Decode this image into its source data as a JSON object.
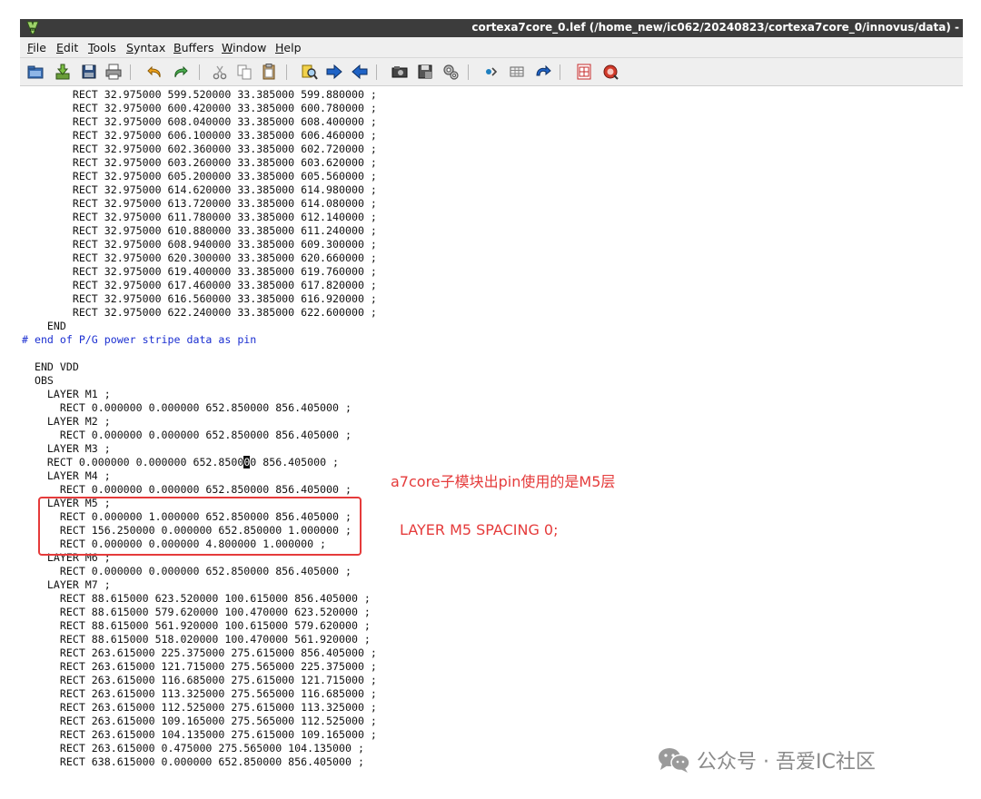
{
  "window": {
    "title": "cortexa7core_0.lef (/home_new/ic062/20240823/cortexa7core_0/innovus/data) -"
  },
  "menu": [
    {
      "pre": "",
      "mn": "F",
      "post": "ile"
    },
    {
      "pre": "",
      "mn": "E",
      "post": "dit"
    },
    {
      "pre": "",
      "mn": "T",
      "post": "ools"
    },
    {
      "pre": "",
      "mn": "S",
      "post": "yntax"
    },
    {
      "pre": "",
      "mn": "B",
      "post": "uffers"
    },
    {
      "pre": "",
      "mn": "W",
      "post": "indow"
    },
    {
      "pre": "",
      "mn": "H",
      "post": "elp"
    }
  ],
  "toolbar_icons": [
    "open-icon",
    "save-icon",
    "save-as-icon",
    "print-icon",
    "undo-icon",
    "redo-icon",
    "cut-icon",
    "copy-icon",
    "paste-icon",
    "find-replace-icon",
    "find-next-icon",
    "find-prev-icon",
    "load-session-icon",
    "save-session-icon",
    "run-script-icon",
    "make-icon",
    "ctags-icon",
    "jump-tag-icon",
    "help-icon",
    "find-help-icon"
  ],
  "colors": {
    "comment": "#1b2fd1",
    "annotation": "#e53b3b",
    "titlebar": "#3c3c3c"
  },
  "cursor_line_index": 27,
  "cursor_line": {
    "before": "    RECT 0.000000 0.000000 652.8500",
    "char": "0",
    "after": "0 856.405000 ;"
  },
  "lines": [
    {
      "text": "        RECT 32.975000 599.520000 33.385000 599.880000 ;",
      "type": "code"
    },
    {
      "text": "        RECT 32.975000 600.420000 33.385000 600.780000 ;",
      "type": "code"
    },
    {
      "text": "        RECT 32.975000 608.040000 33.385000 608.400000 ;",
      "type": "code"
    },
    {
      "text": "        RECT 32.975000 606.100000 33.385000 606.460000 ;",
      "type": "code"
    },
    {
      "text": "        RECT 32.975000 602.360000 33.385000 602.720000 ;",
      "type": "code"
    },
    {
      "text": "        RECT 32.975000 603.260000 33.385000 603.620000 ;",
      "type": "code"
    },
    {
      "text": "        RECT 32.975000 605.200000 33.385000 605.560000 ;",
      "type": "code"
    },
    {
      "text": "        RECT 32.975000 614.620000 33.385000 614.980000 ;",
      "type": "code"
    },
    {
      "text": "        RECT 32.975000 613.720000 33.385000 614.080000 ;",
      "type": "code"
    },
    {
      "text": "        RECT 32.975000 611.780000 33.385000 612.140000 ;",
      "type": "code"
    },
    {
      "text": "        RECT 32.975000 610.880000 33.385000 611.240000 ;",
      "type": "code"
    },
    {
      "text": "        RECT 32.975000 608.940000 33.385000 609.300000 ;",
      "type": "code"
    },
    {
      "text": "        RECT 32.975000 620.300000 33.385000 620.660000 ;",
      "type": "code"
    },
    {
      "text": "        RECT 32.975000 619.400000 33.385000 619.760000 ;",
      "type": "code"
    },
    {
      "text": "        RECT 32.975000 617.460000 33.385000 617.820000 ;",
      "type": "code"
    },
    {
      "text": "        RECT 32.975000 616.560000 33.385000 616.920000 ;",
      "type": "code"
    },
    {
      "text": "        RECT 32.975000 622.240000 33.385000 622.600000 ;",
      "type": "code"
    },
    {
      "text": "    END",
      "type": "code"
    },
    {
      "text": "# end of P/G power stripe data as pin",
      "type": "comment"
    },
    {
      "text": "",
      "type": "code"
    },
    {
      "text": "  END VDD",
      "type": "code"
    },
    {
      "text": "  OBS",
      "type": "code"
    },
    {
      "text": "    LAYER M1 ;",
      "type": "code"
    },
    {
      "text": "      RECT 0.000000 0.000000 652.850000 856.405000 ;",
      "type": "code"
    },
    {
      "text": "    LAYER M2 ;",
      "type": "code"
    },
    {
      "text": "      RECT 0.000000 0.000000 652.850000 856.405000 ;",
      "type": "code"
    },
    {
      "text": "    LAYER M3 ;",
      "type": "code"
    },
    {
      "text": "      RECT 0.000000 0.000000 652.850000 856.405000 ;",
      "type": "code"
    },
    {
      "text": "    LAYER M4 ;",
      "type": "code"
    },
    {
      "text": "      RECT 0.000000 0.000000 652.850000 856.405000 ;",
      "type": "code"
    },
    {
      "text": "    LAYER M5 ;",
      "type": "code"
    },
    {
      "text": "      RECT 0.000000 1.000000 652.850000 856.405000 ;",
      "type": "code"
    },
    {
      "text": "      RECT 156.250000 0.000000 652.850000 1.000000 ;",
      "type": "code"
    },
    {
      "text": "      RECT 0.000000 0.000000 4.800000 1.000000 ;",
      "type": "code"
    },
    {
      "text": "    LAYER M6 ;",
      "type": "code"
    },
    {
      "text": "      RECT 0.000000 0.000000 652.850000 856.405000 ;",
      "type": "code"
    },
    {
      "text": "    LAYER M7 ;",
      "type": "code"
    },
    {
      "text": "      RECT 88.615000 623.520000 100.615000 856.405000 ;",
      "type": "code"
    },
    {
      "text": "      RECT 88.615000 579.620000 100.470000 623.520000 ;",
      "type": "code"
    },
    {
      "text": "      RECT 88.615000 561.920000 100.615000 579.620000 ;",
      "type": "code"
    },
    {
      "text": "      RECT 88.615000 518.020000 100.470000 561.920000 ;",
      "type": "code"
    },
    {
      "text": "      RECT 263.615000 225.375000 275.615000 856.405000 ;",
      "type": "code"
    },
    {
      "text": "      RECT 263.615000 121.715000 275.565000 225.375000 ;",
      "type": "code"
    },
    {
      "text": "      RECT 263.615000 116.685000 275.615000 121.715000 ;",
      "type": "code"
    },
    {
      "text": "      RECT 263.615000 113.325000 275.565000 116.685000 ;",
      "type": "code"
    },
    {
      "text": "      RECT 263.615000 112.525000 275.615000 113.325000 ;",
      "type": "code"
    },
    {
      "text": "      RECT 263.615000 109.165000 275.565000 112.525000 ;",
      "type": "code"
    },
    {
      "text": "      RECT 263.615000 104.135000 275.615000 109.165000 ;",
      "type": "code"
    },
    {
      "text": "      RECT 263.615000 0.475000 275.565000 104.135000 ;",
      "type": "code"
    },
    {
      "text": "      RECT 638.615000 0.000000 652.850000 856.405000 ;",
      "type": "code"
    }
  ],
  "annotations": {
    "note1": "a7core子模块出pin使用的是M5层",
    "note2": "LAYER M5 SPACING  0;"
  },
  "watermark": {
    "text": "公众号 · 吾爱IC社区"
  }
}
